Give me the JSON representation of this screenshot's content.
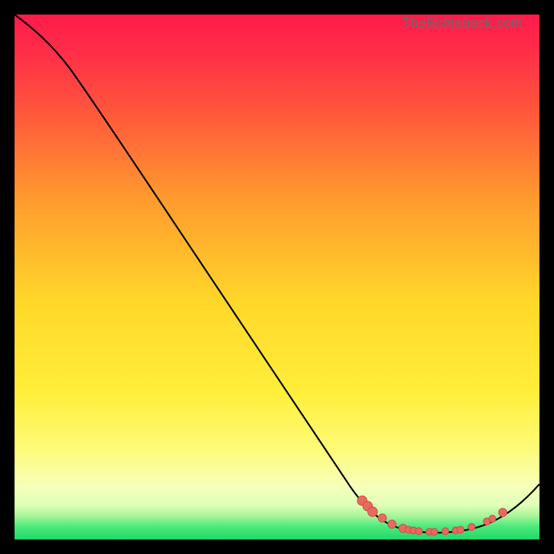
{
  "watermark": "TheBottleneck.com",
  "colors": {
    "top": "#ff1b4a",
    "mid_upper": "#ff8a2a",
    "mid": "#ffe32a",
    "mid_lower": "#fff674",
    "pale": "#f7ffc2",
    "green": "#22e06a",
    "curve_stroke": "#000000",
    "marker_fill": "#e9695e",
    "marker_stroke": "#c94c44"
  },
  "chart_data": {
    "type": "line",
    "title": "",
    "xlabel": "",
    "ylabel": "",
    "xlim": [
      0,
      100
    ],
    "ylim": [
      0,
      100
    ],
    "curve": [
      {
        "x": 0,
        "y": 100
      },
      {
        "x": 5,
        "y": 97
      },
      {
        "x": 10,
        "y": 93
      },
      {
        "x": 15,
        "y": 86
      },
      {
        "x": 20,
        "y": 78
      },
      {
        "x": 30,
        "y": 62
      },
      {
        "x": 40,
        "y": 46
      },
      {
        "x": 50,
        "y": 31
      },
      {
        "x": 60,
        "y": 16
      },
      {
        "x": 65,
        "y": 8
      },
      {
        "x": 70,
        "y": 4
      },
      {
        "x": 74,
        "y": 2
      },
      {
        "x": 80,
        "y": 1.5
      },
      {
        "x": 86,
        "y": 2
      },
      {
        "x": 90,
        "y": 3.5
      },
      {
        "x": 95,
        "y": 7
      },
      {
        "x": 100,
        "y": 11
      }
    ],
    "markers": [
      {
        "x": 66,
        "y": 7.4
      },
      {
        "x": 67,
        "y": 6.2
      },
      {
        "x": 68,
        "y": 5.2
      },
      {
        "x": 70,
        "y": 4.0
      },
      {
        "x": 72,
        "y": 2.9
      },
      {
        "x": 74,
        "y": 2.2
      },
      {
        "x": 75,
        "y": 1.9
      },
      {
        "x": 76,
        "y": 1.8
      },
      {
        "x": 77,
        "y": 1.6
      },
      {
        "x": 79,
        "y": 1.5
      },
      {
        "x": 80,
        "y": 1.5
      },
      {
        "x": 82,
        "y": 1.6
      },
      {
        "x": 84,
        "y": 1.8
      },
      {
        "x": 85,
        "y": 1.9
      },
      {
        "x": 87,
        "y": 2.4
      },
      {
        "x": 90,
        "y": 3.5
      },
      {
        "x": 91,
        "y": 4.0
      },
      {
        "x": 93,
        "y": 5.2
      }
    ]
  }
}
